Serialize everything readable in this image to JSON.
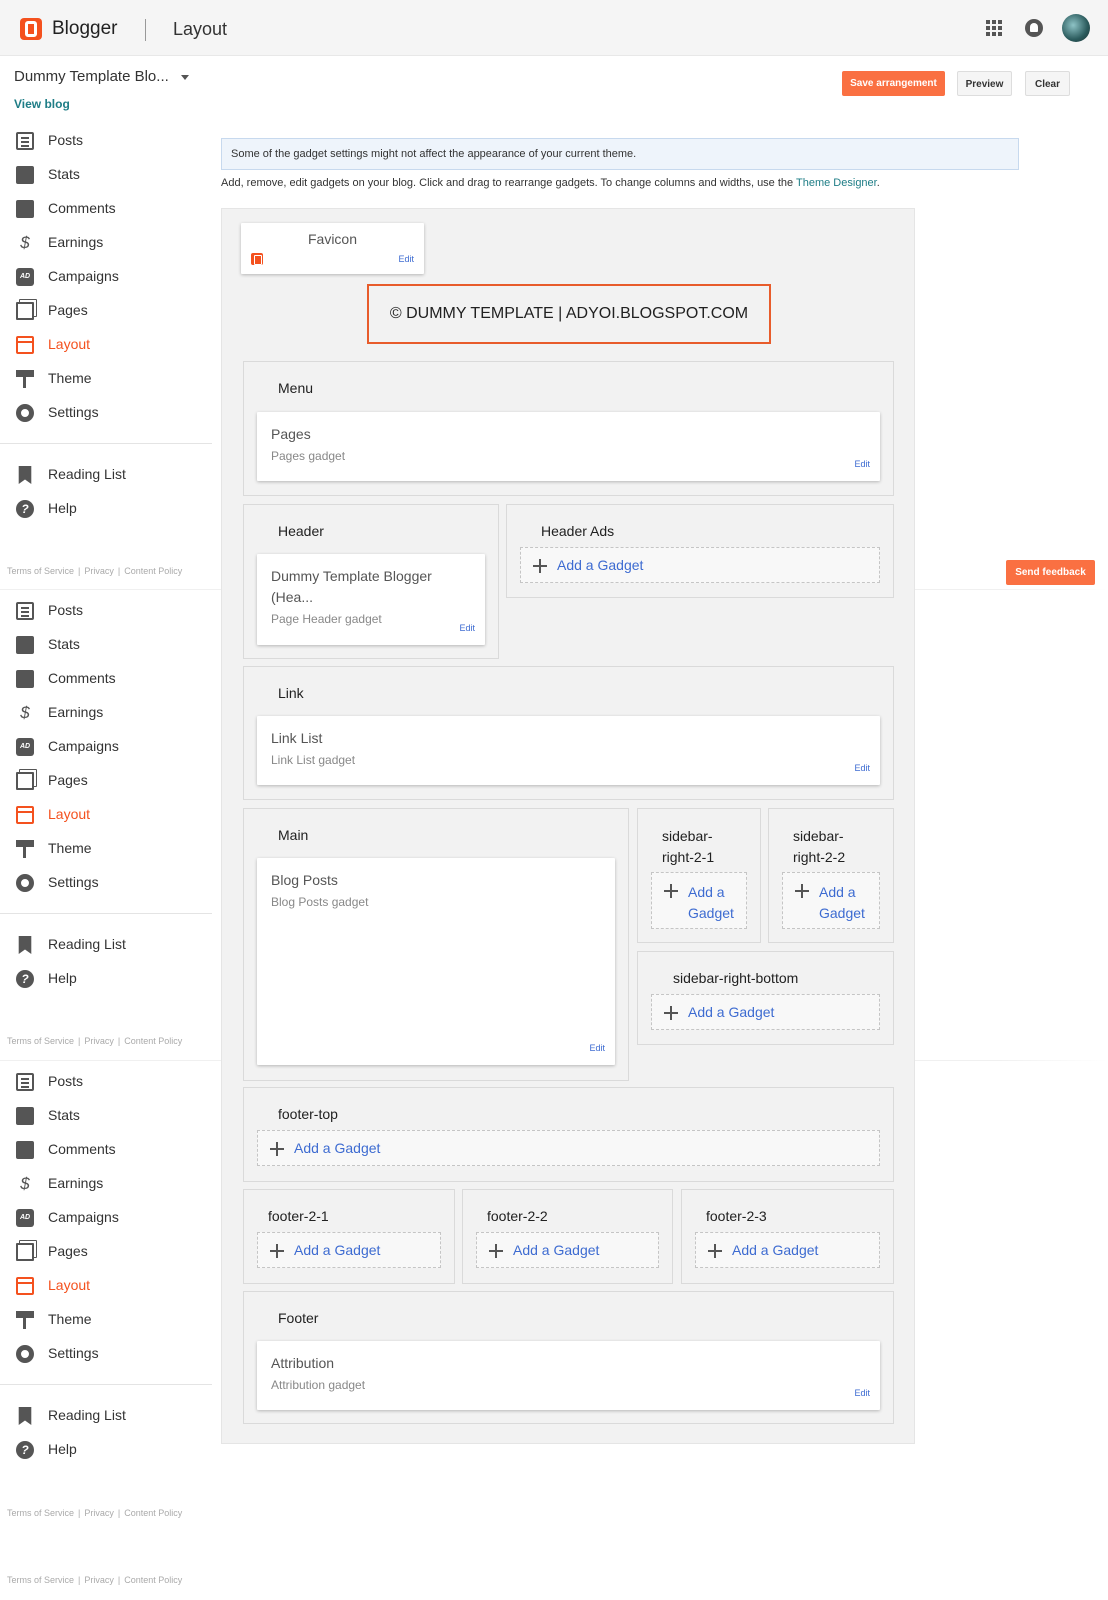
{
  "header": {
    "app_name": "Blogger",
    "page_name": "Layout"
  },
  "sidebar": {
    "blog_title": "Dummy Template Blo...",
    "view_blog": "View blog",
    "items": [
      {
        "label": "Posts",
        "icon": "posts-icon"
      },
      {
        "label": "Stats",
        "icon": "stats-icon"
      },
      {
        "label": "Comments",
        "icon": "comments-icon"
      },
      {
        "label": "Earnings",
        "icon": "earnings-icon"
      },
      {
        "label": "Campaigns",
        "icon": "campaigns-icon"
      },
      {
        "label": "Pages",
        "icon": "pages-icon"
      },
      {
        "label": "Layout",
        "icon": "layout-icon",
        "active": true
      },
      {
        "label": "Theme",
        "icon": "theme-icon"
      },
      {
        "label": "Settings",
        "icon": "settings-icon"
      }
    ],
    "secondary": [
      {
        "label": "Reading List",
        "icon": "reading-list-icon"
      },
      {
        "label": "Help",
        "icon": "help-icon"
      }
    ],
    "footer_links": [
      "Terms of Service",
      "Privacy",
      "Content Policy"
    ]
  },
  "toolbar": {
    "save_label": "Save arrangement",
    "preview_label": "Preview",
    "clear_label": "Clear"
  },
  "feedback_label": "Send feedback",
  "notice": "Some of the gadget settings might not affect the appearance of your current theme.",
  "instructions": {
    "text": "Add, remove, edit gadgets on your blog. Click and drag to rearrange gadgets. To change columns and widths, use the ",
    "link": "Theme Designer",
    "end": "."
  },
  "layout": {
    "favicon": {
      "name": "Favicon",
      "edit": "Edit"
    },
    "copyright": "© DUMMY TEMPLATE | ADYOI.BLOGSPOT.COM",
    "add_gadget": "Add a Gadget",
    "add_gadget_split": {
      "line1": "Add a",
      "line2": "Gadget"
    },
    "edit": "Edit",
    "sections": {
      "menu": {
        "title": "Menu",
        "gadget": {
          "name": "Pages",
          "type": "Pages gadget"
        }
      },
      "header": {
        "title": "Header",
        "gadget": {
          "name_l1": "Dummy Template Blogger",
          "name_l2": "(Hea...",
          "type": "Page Header gadget"
        }
      },
      "header_ads": {
        "title": "Header Ads"
      },
      "link": {
        "title": "Link",
        "gadget": {
          "name": "Link List",
          "type": "Link List gadget"
        }
      },
      "main": {
        "title": "Main",
        "gadget": {
          "name": "Blog Posts",
          "type": "Blog Posts gadget"
        }
      },
      "sidebar_right_2_1": {
        "title_l1": "sidebar-",
        "title_l2": "right-2-1"
      },
      "sidebar_right_2_2": {
        "title_l1": "sidebar-",
        "title_l2": "right-2-2"
      },
      "sidebar_right_bottom": {
        "title": "sidebar-right-bottom"
      },
      "footer_top": {
        "title": "footer-top"
      },
      "footer_2_1": {
        "title": "footer-2-1"
      },
      "footer_2_2": {
        "title": "footer-2-2"
      },
      "footer_2_3": {
        "title": "footer-2-3"
      },
      "footer": {
        "title": "Footer",
        "gadget": {
          "name": "Attribution",
          "type": "Attribution gadget"
        }
      }
    }
  },
  "colors": {
    "brand": "#f4511e",
    "save_button": "#fa7042",
    "link": "#3d6bd1"
  }
}
